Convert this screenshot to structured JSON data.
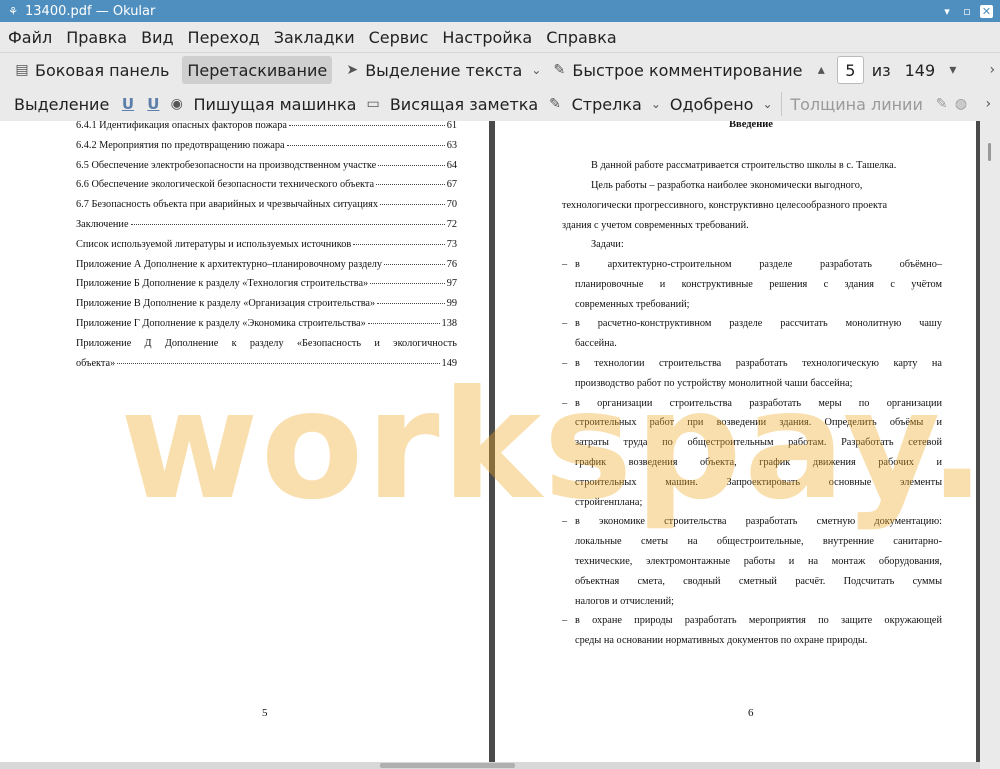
{
  "window": {
    "title": "13400.pdf  — Okular",
    "minimize_glyph": "▾",
    "maximize_glyph": "▫",
    "close_glyph": "✕"
  },
  "menu": [
    "Файл",
    "Правка",
    "Вид",
    "Переход",
    "Закладки",
    "Сервис",
    "Настройка",
    "Справка"
  ],
  "toolbar1": {
    "sidebar": "Боковая панель",
    "drag": "Перетаскивание",
    "select_text": "Выделение текста",
    "quick_comment": "Быстрое комментирование",
    "page_current": "5",
    "of": "из",
    "page_total": "149"
  },
  "toolbar2": {
    "selection": "Выделение",
    "typewriter": "Пишущая машинка",
    "sticky_note": "Висящая заметка",
    "arrow": "Стрелка",
    "approved": "Одобрено",
    "line_width": "Толщина линии"
  },
  "left_page": {
    "toc": [
      {
        "title": "6.4.1 Идентификация опасных факторов пожара",
        "page": "61"
      },
      {
        "title": "6.4.2 Мероприятия по предотвращению пожара",
        "page": "63"
      },
      {
        "title": "6.5 Обеспечение электробезопасности на производственном участке",
        "page": "64"
      },
      {
        "title": "6.6 Обеспечение экологической безопасности технического объекта",
        "page": "67"
      },
      {
        "title": "6.7 Безопасность объекта при аварийных и чрезвычайных ситуациях",
        "page": "70"
      },
      {
        "title": "Заключение",
        "page": "72"
      },
      {
        "title": "Список используемой литературы и используемых источников",
        "page": "73"
      },
      {
        "title": "Приложение А Дополнение к архитектурно–планировочному разделу",
        "page": "76"
      },
      {
        "title": "Приложение Б Дополнение к разделу «Технология строительства»",
        "page": "97"
      },
      {
        "title": "Приложение В Дополнение к разделу «Организация строительства»",
        "page": "99"
      },
      {
        "title": "Приложение Г Дополнение к разделу «Экономика строительства»",
        "page": "138"
      }
    ],
    "toc_last_line1": [
      "Приложение",
      "Д",
      "Дополнение",
      "к",
      "разделу",
      "«Безопасность",
      "и",
      "экологичность"
    ],
    "toc_last_line2": "объекта»",
    "toc_last_page": "149",
    "page_number": "5"
  },
  "right_page": {
    "heading": "Введение",
    "intro": "В данной работе рассматривается строительство школы в с. Ташелка.",
    "goal_l1": "Цель работы – разработка наиболее экономически выгодного,",
    "goal_l2": "технологически прогрессивного, конструктивно целесообразного проекта",
    "goal_l3": "здания с учетом современных требований.",
    "tasks_label": "Задачи:",
    "tasks": [
      {
        "lines": [
          "в архитектурно-строительном разделе разработать объёмно–",
          "планировочные и конструктивные решения с здания с учётом",
          "современных требований;"
        ]
      },
      {
        "lines": [
          "в расчетно-конструктивном разделе рассчитать монолитную чашу",
          "бассейна."
        ]
      },
      {
        "lines": [
          "в технологии строительства разработать технологическую карту на",
          "производство работ по устройству монолитной чаши бассейна;"
        ]
      },
      {
        "lines": [
          "в организации строительства разработать меры по организации",
          "строительных работ при возведении здания. Определить объёмы и",
          "затраты труда по общестроительным работам. Разработать сетевой",
          "график возведения объекта, график движения рабочих и",
          "строительных машин. Запроектировать основные элементы",
          "стройгенплана;"
        ]
      },
      {
        "lines": [
          "в экономике строительства разработать сметную документацию:",
          "локальные сметы на общестроительные, внутренние санитарно-",
          "технические, электромонтажные работы и на монтаж оборудования,",
          "объектная смета, сводный сметный расчёт. Подсчитать суммы",
          "налогов и отчислений;"
        ]
      },
      {
        "lines": [
          "в охране природы разработать мероприятия по защите окружающей",
          "среды на основании нормативных документов по охране природы."
        ]
      }
    ],
    "dash": "–",
    "page_number": "6"
  },
  "watermark": "workspay.ru"
}
